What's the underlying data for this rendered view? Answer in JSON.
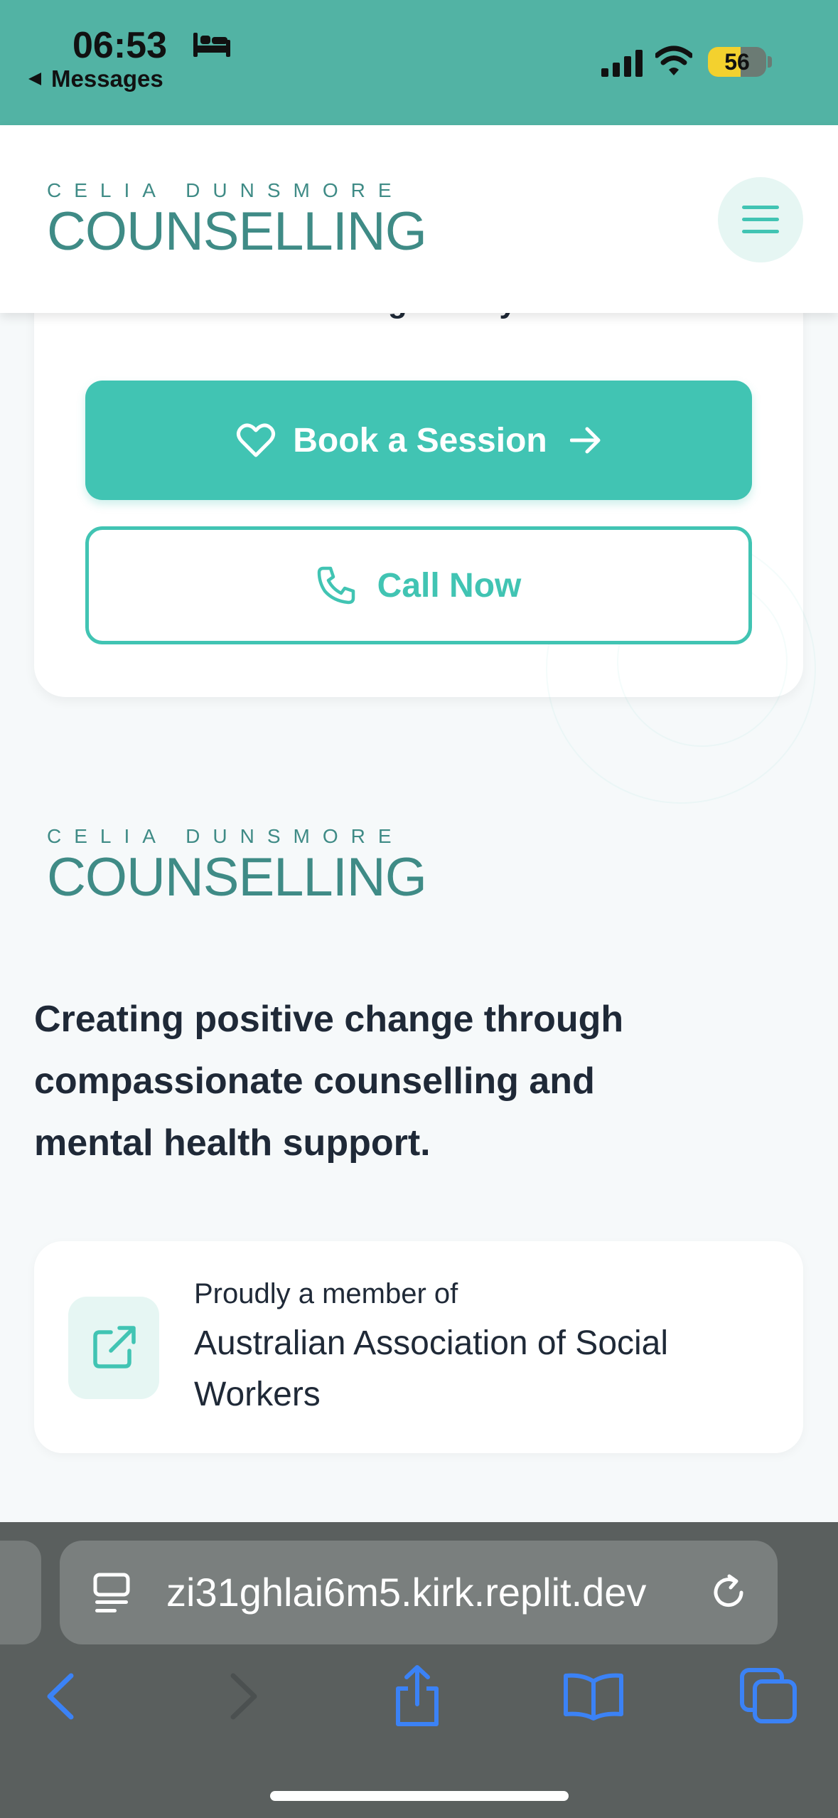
{
  "status_bar": {
    "time": "06:53",
    "back_app": "Messages",
    "battery_level": "56",
    "icons": [
      "bed-icon",
      "signal-icon",
      "wifi-icon",
      "battery-icon"
    ]
  },
  "header": {
    "logo_small": "CELIA DUNSMORE",
    "logo_big": "COUNSELLING",
    "menu_icon": "hamburger-menu-icon"
  },
  "cta": {
    "partial_text": "change today.",
    "book_label": "Book a Session",
    "call_label": "Call Now"
  },
  "footer": {
    "logo_small": "CELIA DUNSMORE",
    "logo_big": "COUNSELLING",
    "tagline_lines": [
      "Creating positive change through",
      "compassionate counselling and",
      "mental health support."
    ],
    "member_label": "Proudly a member of",
    "member_org": "Australian Association of Social Workers",
    "member_icon": "external-link-icon"
  },
  "browser": {
    "url": "zi31ghlai6m5.kirk.replit.dev",
    "toolbar_icons": [
      "back-icon",
      "forward-icon",
      "share-icon",
      "bookmarks-icon",
      "tabs-icon"
    ]
  },
  "colors": {
    "status_bar_bg": "#52b3a4",
    "accent": "#41c4b3",
    "logo": "#3f8b86",
    "page_bg": "#f6f9fa",
    "safari_bar_bg": "#5a5f5e"
  }
}
